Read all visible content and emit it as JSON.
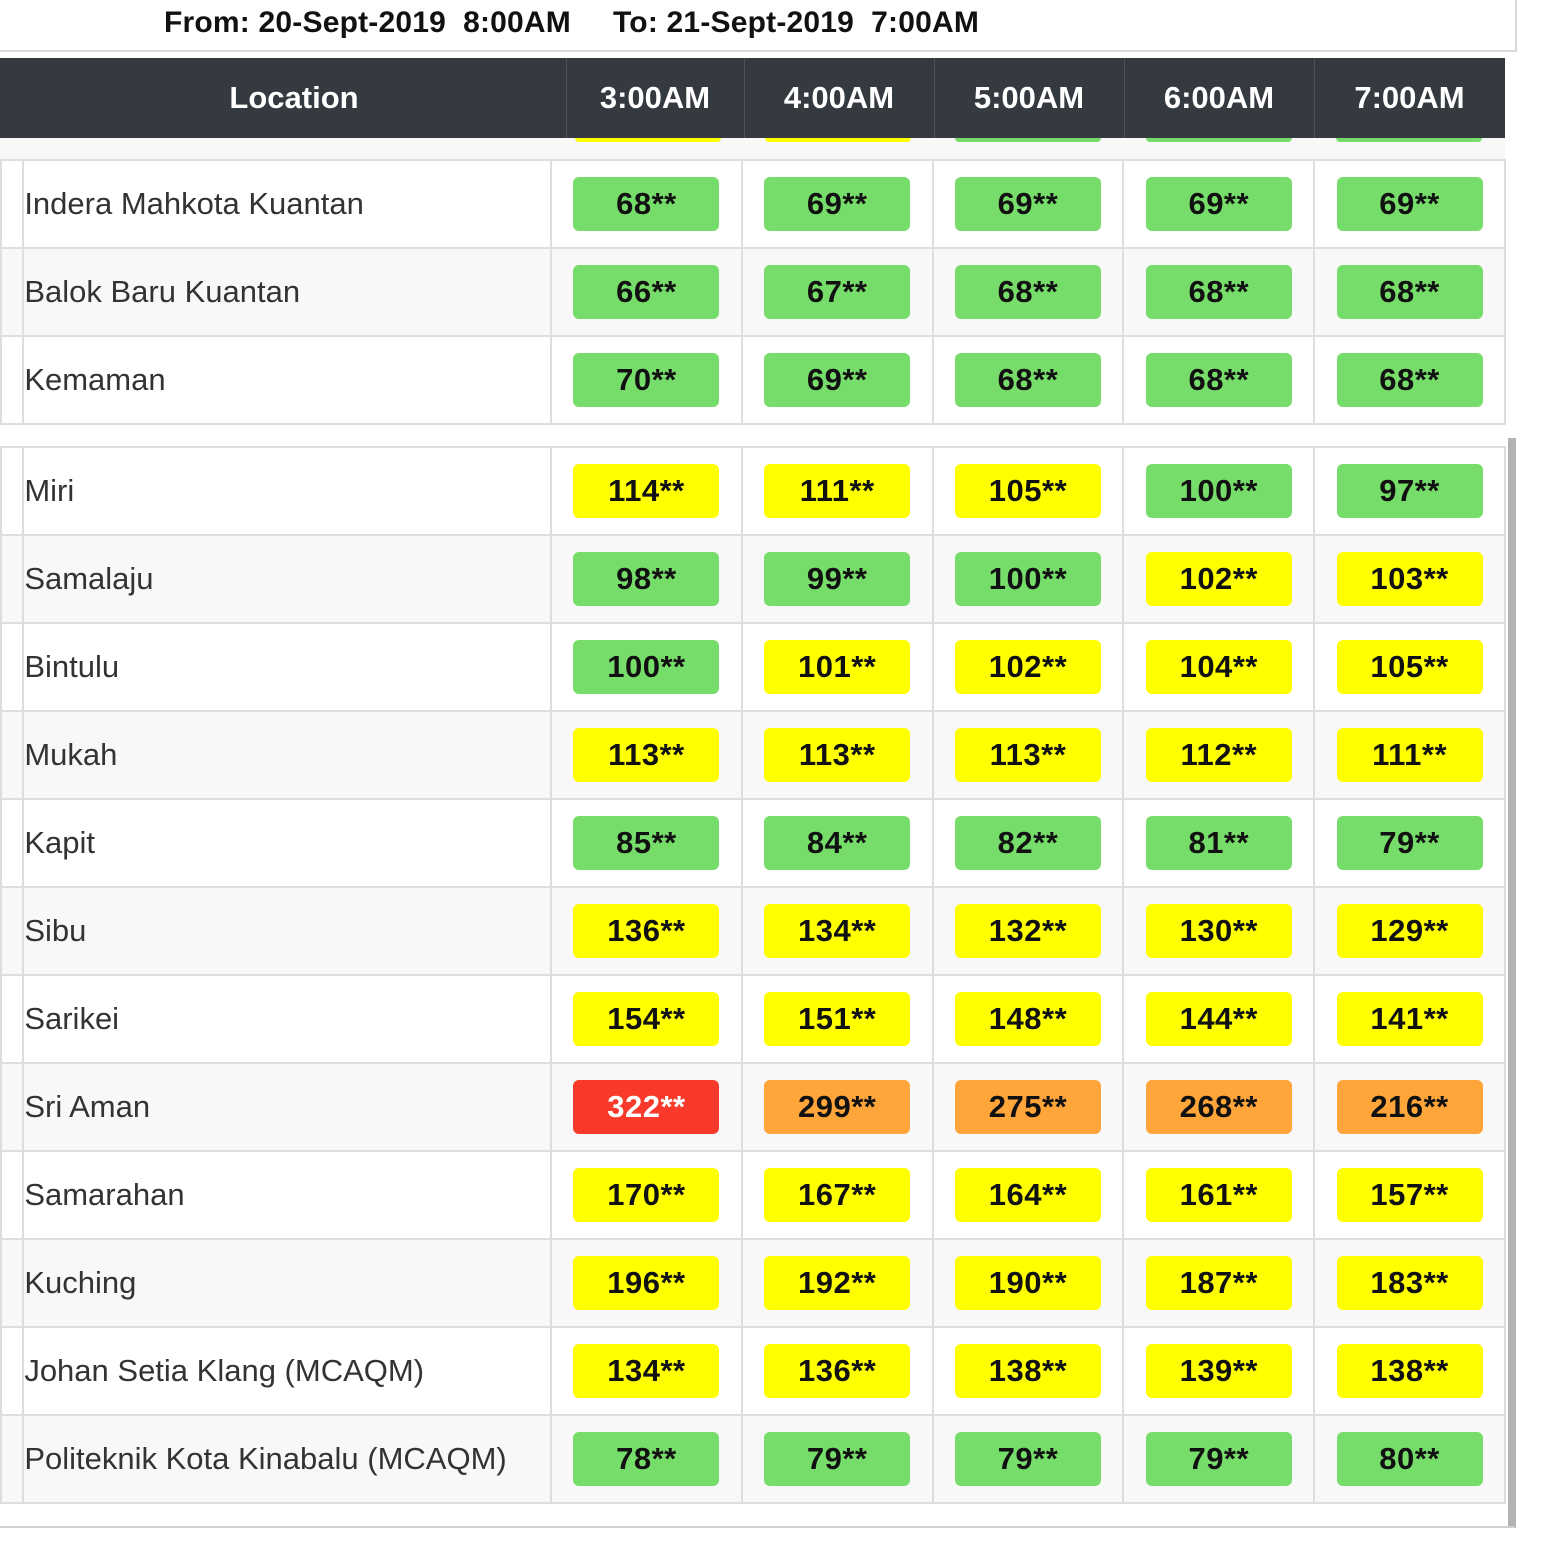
{
  "date_range": {
    "from": "From: 20-Sept-2019  8:00AM",
    "to": "To: 21-Sept-2019  7:00AM"
  },
  "columns": [
    "Location",
    "3:00AM",
    "4:00AM",
    "5:00AM",
    "6:00AM",
    "7:00AM"
  ],
  "legend_colors": {
    "green": "#77dd6a",
    "yellow": "#ffff00",
    "orange": "#ffa53a",
    "red": "#f93a2a",
    "header": "#343a40"
  },
  "group1": [
    {
      "location": "Indera Mahkota Kuantan",
      "values": [
        "68**",
        "69**",
        "69**",
        "69**",
        "69**"
      ],
      "levels": [
        "green",
        "green",
        "green",
        "green",
        "green"
      ]
    },
    {
      "location": "Balok Baru Kuantan",
      "values": [
        "66**",
        "67**",
        "68**",
        "68**",
        "68**"
      ],
      "levels": [
        "green",
        "green",
        "green",
        "green",
        "green"
      ]
    },
    {
      "location": "Kemaman",
      "values": [
        "70**",
        "69**",
        "68**",
        "68**",
        "68**"
      ],
      "levels": [
        "green",
        "green",
        "green",
        "green",
        "green"
      ]
    }
  ],
  "group2": [
    {
      "location": "Miri",
      "values": [
        "114**",
        "111**",
        "105**",
        "100**",
        "97**"
      ],
      "levels": [
        "yellow",
        "yellow",
        "yellow",
        "green",
        "green"
      ]
    },
    {
      "location": "Samalaju",
      "values": [
        "98**",
        "99**",
        "100**",
        "102**",
        "103**"
      ],
      "levels": [
        "green",
        "green",
        "green",
        "yellow",
        "yellow"
      ]
    },
    {
      "location": "Bintulu",
      "values": [
        "100**",
        "101**",
        "102**",
        "104**",
        "105**"
      ],
      "levels": [
        "green",
        "yellow",
        "yellow",
        "yellow",
        "yellow"
      ]
    },
    {
      "location": "Mukah",
      "values": [
        "113**",
        "113**",
        "113**",
        "112**",
        "111**"
      ],
      "levels": [
        "yellow",
        "yellow",
        "yellow",
        "yellow",
        "yellow"
      ]
    },
    {
      "location": "Kapit",
      "values": [
        "85**",
        "84**",
        "82**",
        "81**",
        "79**"
      ],
      "levels": [
        "green",
        "green",
        "green",
        "green",
        "green"
      ]
    },
    {
      "location": "Sibu",
      "values": [
        "136**",
        "134**",
        "132**",
        "130**",
        "129**"
      ],
      "levels": [
        "yellow",
        "yellow",
        "yellow",
        "yellow",
        "yellow"
      ]
    },
    {
      "location": "Sarikei",
      "values": [
        "154**",
        "151**",
        "148**",
        "144**",
        "141**"
      ],
      "levels": [
        "yellow",
        "yellow",
        "yellow",
        "yellow",
        "yellow"
      ]
    },
    {
      "location": "Sri Aman",
      "values": [
        "322**",
        "299**",
        "275**",
        "268**",
        "216**"
      ],
      "levels": [
        "red",
        "orange",
        "orange",
        "orange",
        "orange"
      ]
    },
    {
      "location": "Samarahan",
      "values": [
        "170**",
        "167**",
        "164**",
        "161**",
        "157**"
      ],
      "levels": [
        "yellow",
        "yellow",
        "yellow",
        "yellow",
        "yellow"
      ]
    },
    {
      "location": "Kuching",
      "values": [
        "196**",
        "192**",
        "190**",
        "187**",
        "183**"
      ],
      "levels": [
        "yellow",
        "yellow",
        "yellow",
        "yellow",
        "yellow"
      ]
    },
    {
      "location": "Johan Setia Klang (MCAQM)",
      "values": [
        "134**",
        "136**",
        "138**",
        "139**",
        "138**"
      ],
      "levels": [
        "yellow",
        "yellow",
        "yellow",
        "yellow",
        "yellow"
      ]
    },
    {
      "location": "Politeknik Kota Kinabalu (MCAQM)",
      "values": [
        "78**",
        "79**",
        "79**",
        "79**",
        "80**"
      ],
      "levels": [
        "green",
        "green",
        "green",
        "green",
        "green"
      ]
    }
  ]
}
